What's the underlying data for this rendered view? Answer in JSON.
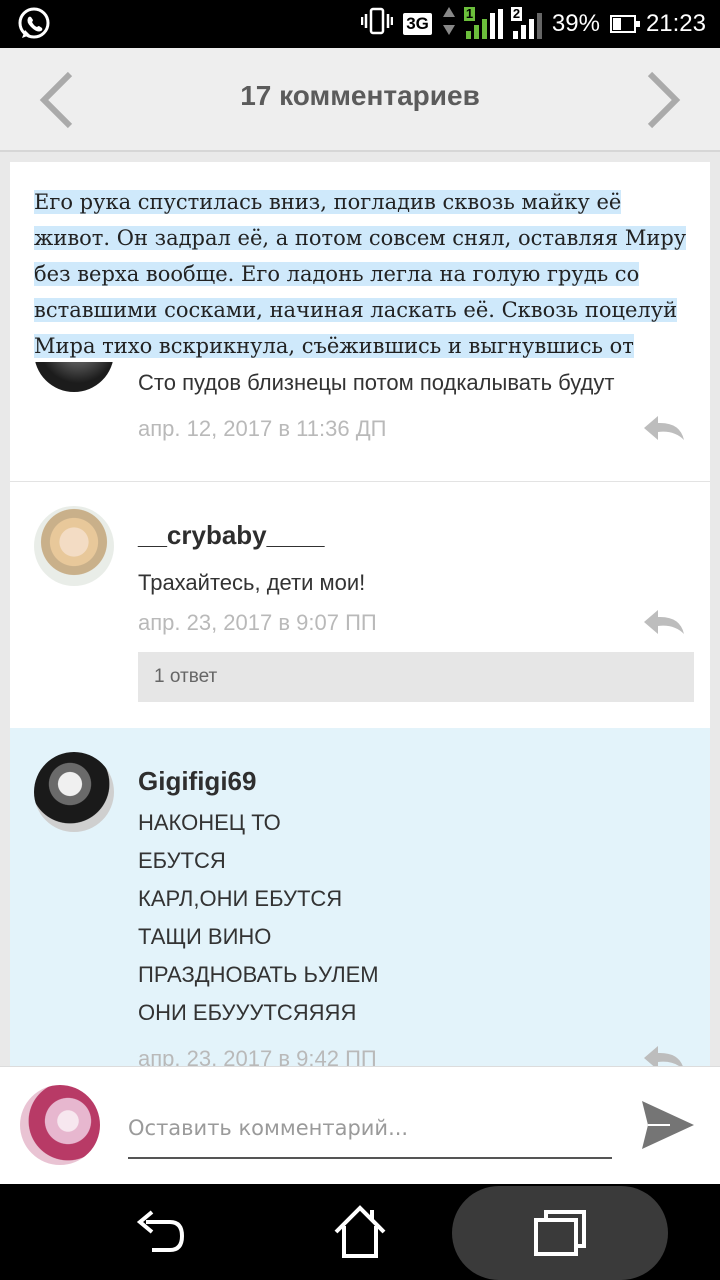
{
  "status_bar": {
    "app_icon": "whatsapp-icon",
    "network_type": "3G",
    "sim1_badge": "1",
    "sim2_badge": "2",
    "battery_percent": "39%",
    "battery_level": 0.39,
    "time": "21:23"
  },
  "header": {
    "title": "17 комментариев",
    "prev_icon": "chevron-left-icon",
    "next_icon": "chevron-right-icon"
  },
  "excerpt": {
    "lines": [
      "Его рука спустилась вниз, погладив сквозь майку её",
      "живот. Он задрал её, а потом совсем снял, оставляя Миру",
      "без верха вообще. Его ладонь легла на голую грудь со",
      "вставшими сосками, начиная ласкать её. Сквозь поцелуй",
      "Мира тихо вскрикнула, съёжившись и выгнувшись от"
    ]
  },
  "comments": [
    {
      "text": "Сто пудов  близнецы потом подкалывать будут",
      "date": "апр. 12, 2017 в 11:36 ДП"
    },
    {
      "username": "__crybaby____",
      "text": "Трахайтесь, дети мои!",
      "date": "апр. 23, 2017 в 9:07 ПП",
      "replies_label": "1 ответ"
    },
    {
      "username": "Gigifigi69",
      "lines": [
        "НАКОНЕЦ ТО",
        "ЕБУТСЯ",
        "КАРЛ,ОНИ ЕБУТСЯ",
        "ТАЩИ ВИНО",
        "ПРАЗДНОВАТЬ ЬУЛЕМ",
        "ОНИ ЕБУУУТСЯЯЯЯ"
      ],
      "date": "апр. 23, 2017 в 9:42 ПП"
    }
  ],
  "composer": {
    "placeholder": "Оставить комментарий...",
    "send_icon": "send-icon"
  },
  "colors": {
    "highlight": "#cfe9fb",
    "selected_comment_bg": "#e3f3fa",
    "header_bg": "#eeeeee",
    "date_text": "#b9b9b9"
  }
}
